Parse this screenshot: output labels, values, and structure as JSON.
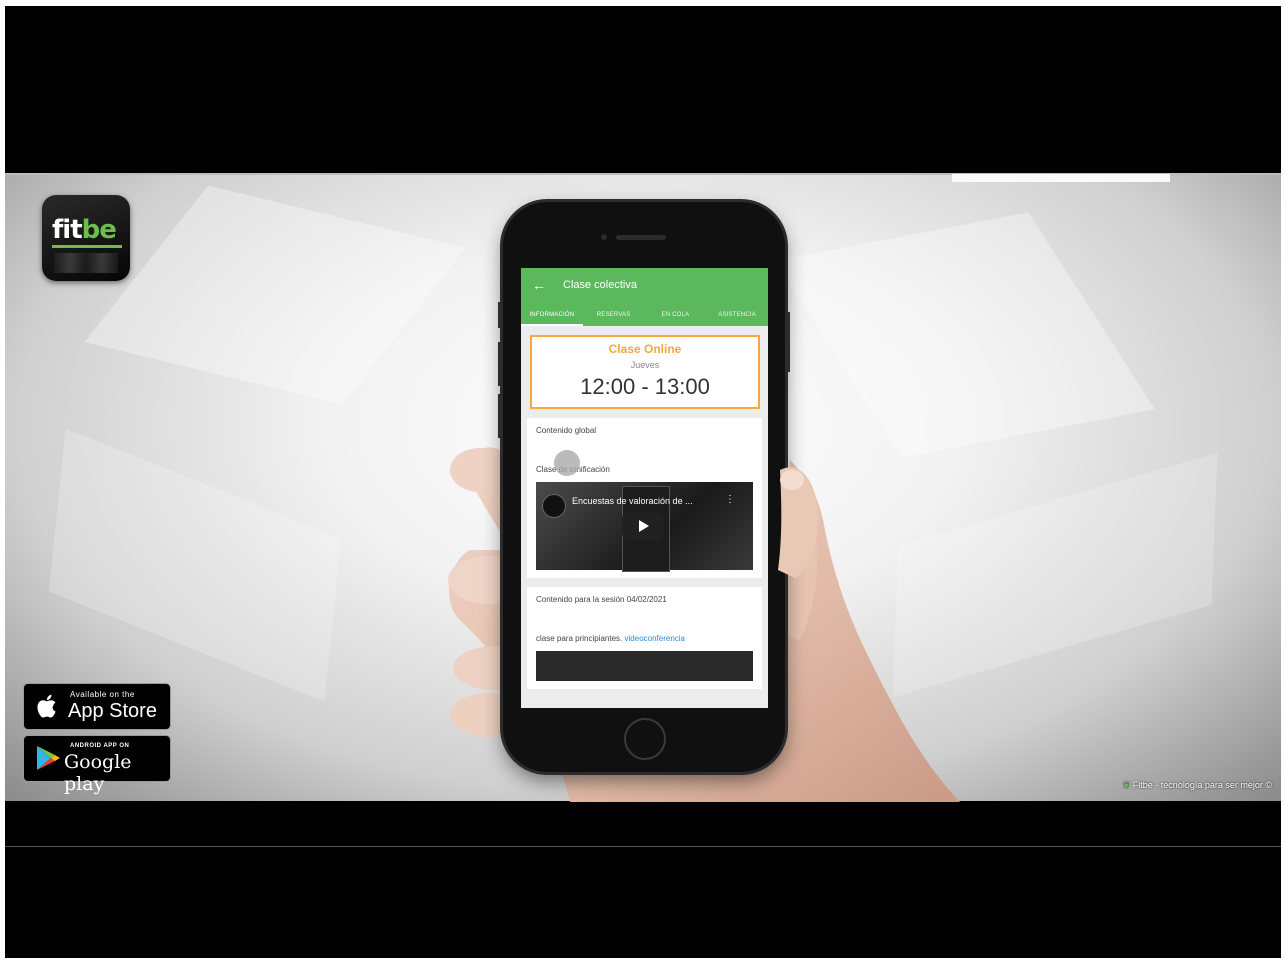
{
  "branding": {
    "logo_main": "fit",
    "logo_accent": "be",
    "logo_color": "#6cc04a"
  },
  "store_badges": {
    "apple_small": "Available on the",
    "apple_big": "App Store",
    "google_small": "ANDROID APP ON",
    "google_big": "Google play"
  },
  "footer": {
    "credit": "Fitbe - tecnología para ser mejor ©"
  },
  "app": {
    "header": {
      "back_icon": "arrow-left-icon",
      "title": "Clase colectiva"
    },
    "tabs": [
      "INFORMACIÓN",
      "RESERVAS",
      "EN COLA",
      "ASISTENCIA"
    ],
    "class_card": {
      "title": "Clase Online",
      "day": "Jueves",
      "time": "12:00 - 13:00",
      "accent": "#f2a742"
    },
    "global_content": {
      "label": "Contenido global",
      "subtitle": "Clase de tonificación",
      "video_title": "Encuestas de valoración de ..."
    },
    "session_content": {
      "label": "Contenido para la sesión 04/02/2021",
      "text": "clase para principiantes.",
      "link": "videoconferencia"
    },
    "primary_color": "#5cb85c"
  }
}
